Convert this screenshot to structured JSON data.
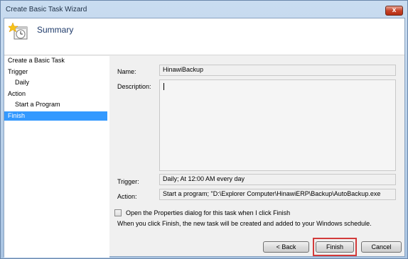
{
  "window": {
    "title": "Create Basic Task Wizard",
    "close_label": "x"
  },
  "header": {
    "title": "Summary",
    "icon": "task-clock-icon"
  },
  "sidebar": {
    "items": [
      {
        "label": "Create a Basic Task",
        "level": 0,
        "selected": false
      },
      {
        "label": "Trigger",
        "level": 0,
        "selected": false
      },
      {
        "label": "Daily",
        "level": 1,
        "selected": false
      },
      {
        "label": "Action",
        "level": 0,
        "selected": false
      },
      {
        "label": "Start a Program",
        "level": 1,
        "selected": false
      },
      {
        "label": "Finish",
        "level": 0,
        "selected": true
      }
    ]
  },
  "form": {
    "name_label": "Name:",
    "name_value": "HinawiBackup",
    "description_label": "Description:",
    "description_value": "",
    "trigger_label": "Trigger:",
    "trigger_value": "Daily; At 12:00 AM every day",
    "action_label": "Action:",
    "action_value": "Start a program; \"D:\\Explorer Computer\\HinawiERP\\Backup\\AutoBackup.exe"
  },
  "options": {
    "open_properties_label": "Open the Properties dialog for this task when I click Finish",
    "open_properties_checked": false,
    "info_text": "When you click Finish, the new task will be created and added to your Windows schedule."
  },
  "buttons": {
    "back": "< Back",
    "finish": "Finish",
    "cancel": "Cancel"
  },
  "colors": {
    "selected": "#3399ff",
    "highlight": "#d23a3a"
  }
}
